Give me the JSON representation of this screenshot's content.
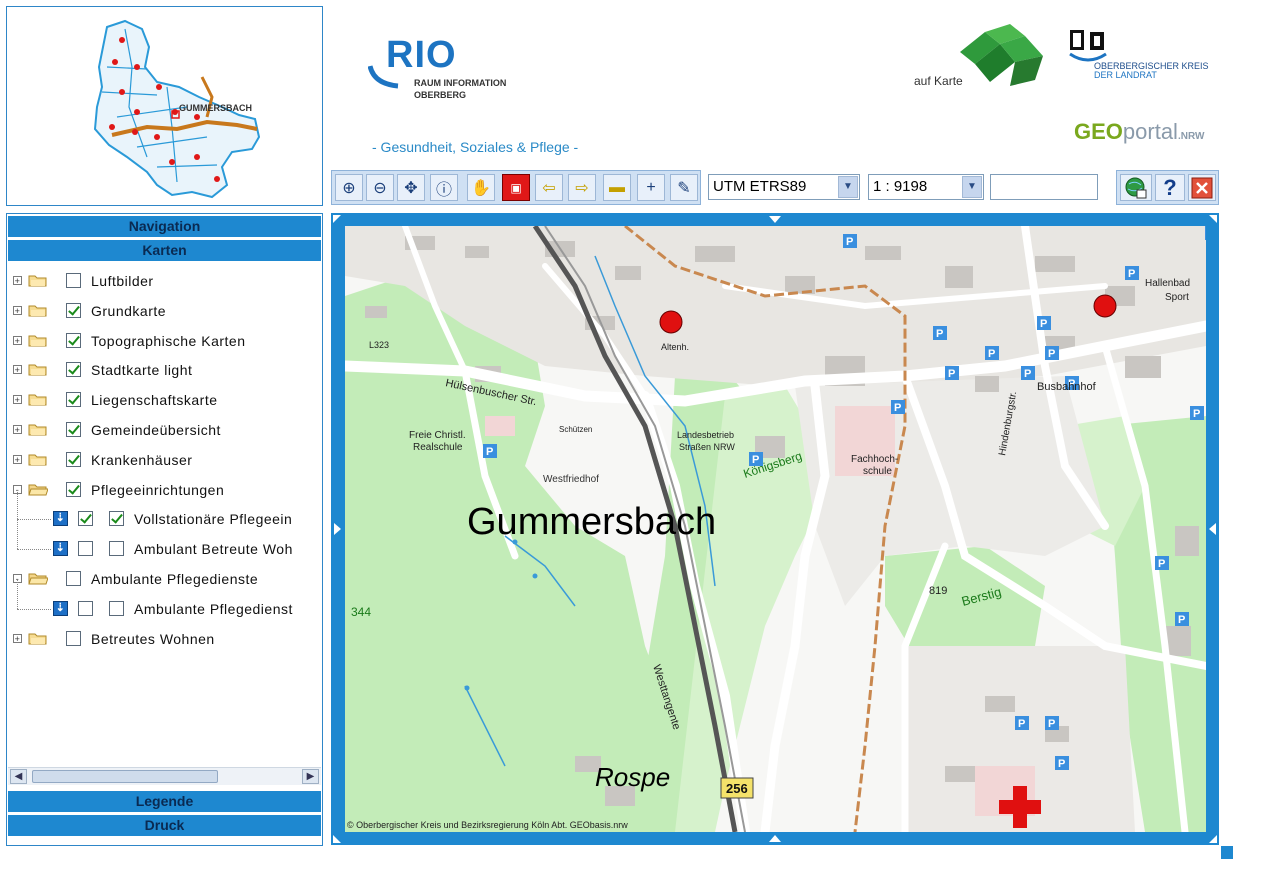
{
  "header": {
    "logo_title": "RIO",
    "logo_line1": "RAUM INFORMATION",
    "logo_line2": "OBERBERG",
    "subtitle": "- Gesundheit, Soziales & Pflege -",
    "aufkarte": "auf Karte",
    "kreis_line1": "OBERBERGISCHER KREIS",
    "kreis_line2": "DER LANDRAT",
    "geoportal_a": "GEO",
    "geoportal_b": "portal",
    "geoportal_c": ".NRW"
  },
  "overview": {
    "label": "GUMMERSBACH"
  },
  "panels": {
    "navigation": "Navigation",
    "karten": "Karten",
    "legende": "Legende",
    "druck": "Druck"
  },
  "layers": [
    {
      "label": "Luftbilder",
      "checked": false
    },
    {
      "label": "Grundkarte",
      "checked": true
    },
    {
      "label": "Topographische Karten",
      "checked": true
    },
    {
      "label": "Stadtkarte light",
      "checked": true
    },
    {
      "label": "Liegenschaftskarte",
      "checked": true
    },
    {
      "label": "Gemeindeübersicht",
      "checked": true
    },
    {
      "label": "Krankenhäuser",
      "checked": true
    },
    {
      "label": "Pflegeeinrichtungen",
      "checked": true
    },
    {
      "label": "Vollstationäre Pflegeein",
      "checked": true
    },
    {
      "label": "Ambulant Betreute Woh",
      "checked": false
    },
    {
      "label": "Ambulante Pflegedienste",
      "checked": false
    },
    {
      "label": "Ambulante Pflegedienst",
      "checked": false
    },
    {
      "label": "Betreutes Wohnen",
      "checked": false
    }
  ],
  "toolbar": {
    "projection": "UTM ETRS89",
    "scale": "1 : 9198",
    "coord_value": ""
  },
  "map": {
    "town_label": "Gummersbach",
    "rospe_label": "Rospe",
    "road_number": "256",
    "copyright": "© Oberbergischer Kreis und Bezirksregierung Köln Abt. GEObasis.nrw",
    "labels": {
      "westfriedhof": "Westfriedhof",
      "koenigsberg": "Königsberg",
      "berstig": "Berstig",
      "busbahnhof": "Busbahnhof",
      "fachhoch": "Fachhoch-",
      "schule": "schule",
      "huelsenbuscher": "Hülsenbuscher Str.",
      "westtangente": "Westtangente",
      "freie": "Freie Christl.",
      "realschule": "Realschule",
      "landesbetrieb": "Landesbetrieb",
      "strassen": "Straßen NRW",
      "hindenburg": "Hindenburgstr.",
      "schuetzen": "Schützen",
      "altenh": "Altenh.",
      "l323": "L323",
      "n819": "819",
      "n344": "344",
      "hallenbad": "Hallenbad",
      "sport": "Sport"
    }
  }
}
